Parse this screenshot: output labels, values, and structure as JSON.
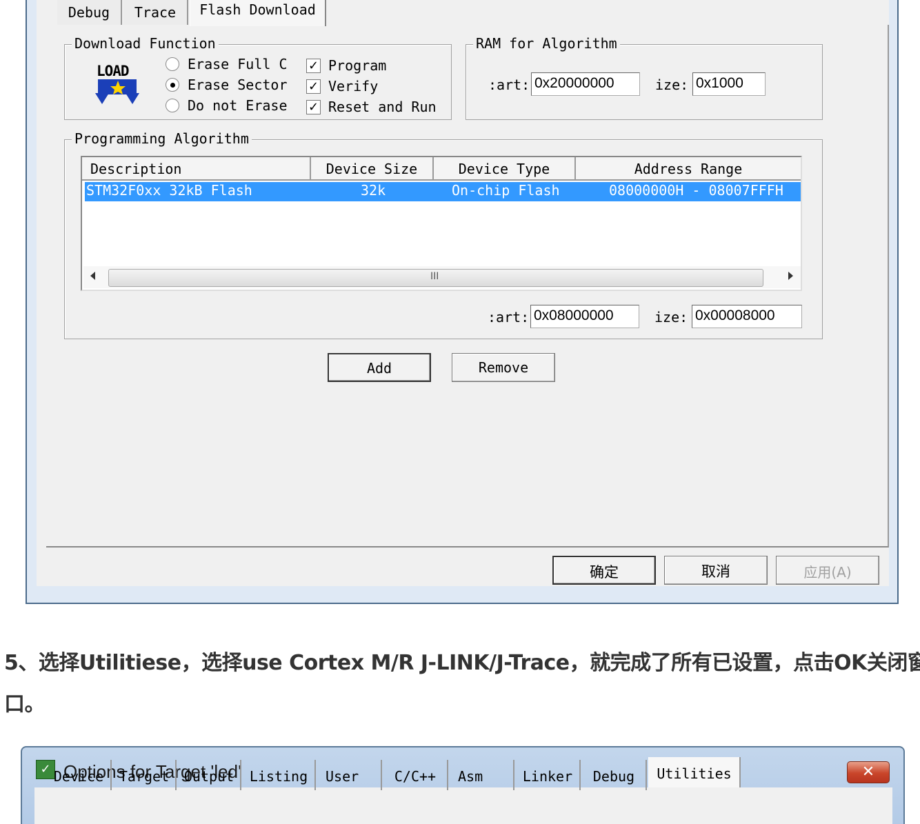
{
  "dialog1": {
    "tabs": [
      {
        "label": "Debug"
      },
      {
        "label": "Trace"
      },
      {
        "label": "Flash Download"
      }
    ],
    "download_function": {
      "title": "Download Function",
      "icon_text": "LOAD",
      "radios": [
        {
          "label": "Erase Full C",
          "selected": false
        },
        {
          "label": "Erase Sector",
          "selected": true
        },
        {
          "label": "Do not Erase",
          "selected": false
        }
      ],
      "checks": [
        {
          "label": "Program",
          "checked": true
        },
        {
          "label": "Verify",
          "checked": true
        },
        {
          "label": "Reset and Run",
          "checked": true
        }
      ]
    },
    "ram_for_algorithm": {
      "title": "RAM for Algorithm",
      "start_label": ":art:",
      "start_value": "0x20000000",
      "size_label": "ize:",
      "size_value": "0x1000"
    },
    "programming_algorithm": {
      "title": "Programming Algorithm",
      "columns": [
        "Description",
        "Device Size",
        "Device Type",
        "Address Range"
      ],
      "rows": [
        {
          "description": "STM32F0xx 32kB Flash",
          "device_size": "32k",
          "device_type": "On-chip Flash",
          "address_range": "08000000H - 08007FFFH"
        }
      ],
      "scroll_grip": "III",
      "start_label": ":art:",
      "start_value": "0x08000000",
      "size_label": "ize:",
      "size_value": "0x00008000",
      "add_label": "Add",
      "remove_label": "Remove"
    },
    "footer": {
      "ok_label": "确定",
      "cancel_label": "取消",
      "apply_label": "应用(A)"
    }
  },
  "article": {
    "line1": "5、选择Utilitiese，选择use Cortex M/R J-LINK/J-Trace，就完成了所有已设置，点击OK关闭窗",
    "line2": "口。"
  },
  "dialog2": {
    "title": "Options for Target 'led'",
    "close_symbol": "✕",
    "tabs": [
      {
        "label": "Device"
      },
      {
        "label": "Target"
      },
      {
        "label": "Output"
      },
      {
        "label": "Listing"
      },
      {
        "label": "User"
      },
      {
        "label": "C/C++"
      },
      {
        "label": "Asm"
      },
      {
        "label": "Linker"
      },
      {
        "label": "Debug"
      },
      {
        "label": "Utilities"
      }
    ],
    "active_tab": "Utilities"
  }
}
